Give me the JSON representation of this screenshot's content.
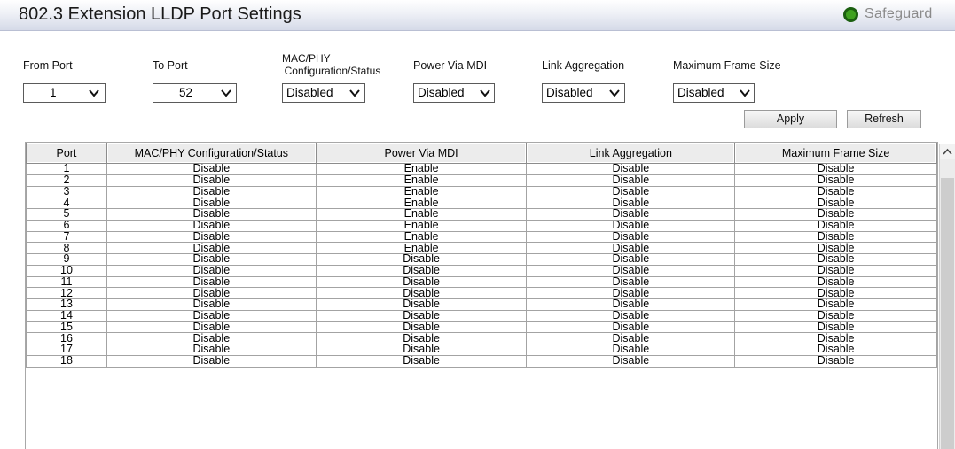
{
  "header": {
    "title": "802.3 Extension LLDP Port Settings",
    "safeguard_label": "Safeguard"
  },
  "form": {
    "from_port": {
      "label": "From Port",
      "value": "1"
    },
    "to_port": {
      "label": "To Port",
      "value": "52"
    },
    "mac_phy": {
      "label_line1": "MAC/PHY",
      "label_line2": "Configuration/Status",
      "value": "Disabled"
    },
    "power_via_mdi": {
      "label": "Power Via MDI",
      "value": "Disabled"
    },
    "link_aggregation": {
      "label": "Link Aggregation",
      "value": "Disabled"
    },
    "max_frame_size": {
      "label": "Maximum Frame Size",
      "value": "Disabled"
    },
    "apply_label": "Apply",
    "refresh_label": "Refresh"
  },
  "table": {
    "headers": [
      "Port",
      "MAC/PHY Configuration/Status",
      "Power Via MDI",
      "Link Aggregation",
      "Maximum Frame Size"
    ],
    "rows": [
      [
        "1",
        "Disable",
        "Enable",
        "Disable",
        "Disable"
      ],
      [
        "2",
        "Disable",
        "Enable",
        "Disable",
        "Disable"
      ],
      [
        "3",
        "Disable",
        "Enable",
        "Disable",
        "Disable"
      ],
      [
        "4",
        "Disable",
        "Enable",
        "Disable",
        "Disable"
      ],
      [
        "5",
        "Disable",
        "Enable",
        "Disable",
        "Disable"
      ],
      [
        "6",
        "Disable",
        "Enable",
        "Disable",
        "Disable"
      ],
      [
        "7",
        "Disable",
        "Enable",
        "Disable",
        "Disable"
      ],
      [
        "8",
        "Disable",
        "Enable",
        "Disable",
        "Disable"
      ],
      [
        "9",
        "Disable",
        "Disable",
        "Disable",
        "Disable"
      ],
      [
        "10",
        "Disable",
        "Disable",
        "Disable",
        "Disable"
      ],
      [
        "11",
        "Disable",
        "Disable",
        "Disable",
        "Disable"
      ],
      [
        "12",
        "Disable",
        "Disable",
        "Disable",
        "Disable"
      ],
      [
        "13",
        "Disable",
        "Disable",
        "Disable",
        "Disable"
      ],
      [
        "14",
        "Disable",
        "Disable",
        "Disable",
        "Disable"
      ],
      [
        "15",
        "Disable",
        "Disable",
        "Disable",
        "Disable"
      ],
      [
        "16",
        "Disable",
        "Disable",
        "Disable",
        "Disable"
      ],
      [
        "17",
        "Disable",
        "Disable",
        "Disable",
        "Disable"
      ],
      [
        "18",
        "Disable",
        "Disable",
        "Disable",
        "Disable"
      ]
    ]
  },
  "colors": {
    "safeguard_green": "#3ea11f",
    "header_gradient_bottom": "#d5dae8",
    "table_header_bg": "#ececec"
  },
  "icons": {
    "dropdown": "chevron-down-icon",
    "scroll_up": "scroll-up-arrow-icon",
    "status": "safeguard-status-icon"
  }
}
